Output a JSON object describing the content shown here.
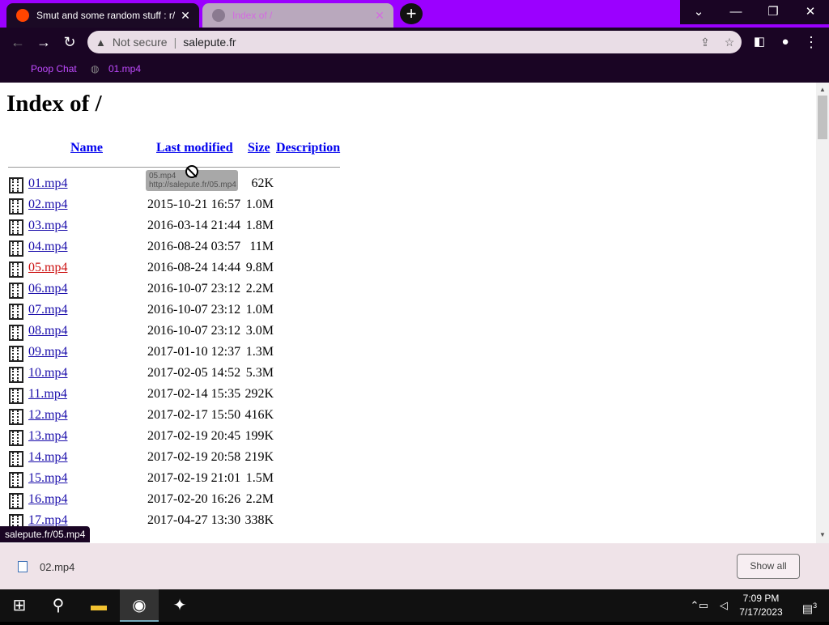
{
  "tabs": [
    {
      "title": "Smut and some random stuff : r/",
      "active": true
    },
    {
      "title": "Index of /",
      "active": false
    }
  ],
  "window_controls": {
    "dropdown": "⌄",
    "minimize": "—",
    "restore": "❐",
    "close": "✕"
  },
  "address": {
    "security_label": "Not secure",
    "url": "salepute.fr"
  },
  "bookmarks": [
    {
      "label": "Poop Chat"
    },
    {
      "label": "01.mp4"
    }
  ],
  "page": {
    "heading": "Index of /",
    "columns": {
      "name": "Name",
      "modified": "Last modified",
      "size": "Size",
      "description": "Description"
    },
    "files": [
      {
        "name": "01.mp4",
        "modified": "",
        "size": "62K"
      },
      {
        "name": "02.mp4",
        "modified": "2015-10-21 16:57",
        "size": "1.0M"
      },
      {
        "name": "03.mp4",
        "modified": "2016-03-14 21:44",
        "size": "1.8M"
      },
      {
        "name": "04.mp4",
        "modified": "2016-08-24 03:57",
        "size": "11M"
      },
      {
        "name": "05.mp4",
        "modified": "2016-08-24 14:44",
        "size": "9.8M"
      },
      {
        "name": "06.mp4",
        "modified": "2016-10-07 23:12",
        "size": "2.2M"
      },
      {
        "name": "07.mp4",
        "modified": "2016-10-07 23:12",
        "size": "1.0M"
      },
      {
        "name": "08.mp4",
        "modified": "2016-10-07 23:12",
        "size": "3.0M"
      },
      {
        "name": "09.mp4",
        "modified": "2017-01-10 12:37",
        "size": "1.3M"
      },
      {
        "name": "10.mp4",
        "modified": "2017-02-05 14:52",
        "size": "5.3M"
      },
      {
        "name": "11.mp4",
        "modified": "2017-02-14 15:35",
        "size": "292K"
      },
      {
        "name": "12.mp4",
        "modified": "2017-02-17 15:50",
        "size": "416K"
      },
      {
        "name": "13.mp4",
        "modified": "2017-02-19 20:45",
        "size": "199K"
      },
      {
        "name": "14.mp4",
        "modified": "2017-02-19 20:58",
        "size": "219K"
      },
      {
        "name": "15.mp4",
        "modified": "2017-02-19 21:01",
        "size": "1.5M"
      },
      {
        "name": "16.mp4",
        "modified": "2017-02-20 16:26",
        "size": "2.2M"
      },
      {
        "name": "17.mp4",
        "modified": "2017-04-27 13:30",
        "size": "338K"
      }
    ],
    "drag_ghost": {
      "title": "05.mp4",
      "url": "http://salepute.fr/05.mp4"
    }
  },
  "status_url": "salepute.fr/05.mp4",
  "download": {
    "file": "02.mp4",
    "show_all": "Show all"
  },
  "taskbar": {
    "time": "7:09 PM",
    "date": "7/17/2023",
    "notification_count": "3"
  },
  "colors": {
    "tabstrip": "#9b00ff",
    "toolbar": "#1a0524",
    "visited_link": "#1a0dab",
    "active_link": "#cc1111"
  }
}
